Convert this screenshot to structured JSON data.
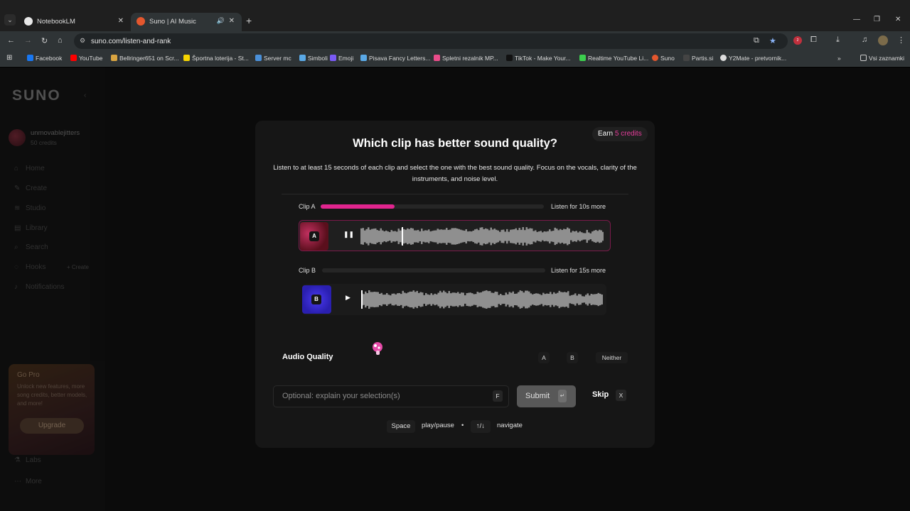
{
  "browser": {
    "tabs": [
      {
        "title": "NotebookLM",
        "active": false
      },
      {
        "title": "Suno | AI Music",
        "active": true
      }
    ],
    "url": "suno.com/listen-and-rank",
    "extension_badge": "2",
    "bookmarks": [
      {
        "label": "Facebook",
        "color": "#1877f2"
      },
      {
        "label": "YouTube",
        "color": "#ff0000"
      },
      {
        "label": "Bellringer651 on Scr...",
        "color": "#d9a441"
      },
      {
        "label": "Športna loterija - St...",
        "color": "#f5d400"
      },
      {
        "label": "Server mc",
        "color": "#4a90d9"
      },
      {
        "label": "Simboli",
        "color": "#5aa9e6"
      },
      {
        "label": "Emoji",
        "color": "#7a5af5"
      },
      {
        "label": "Pisava Fancy Letters...",
        "color": "#5aa9e6"
      },
      {
        "label": "Spletni rezalnik MP...",
        "color": "#e94c8a"
      },
      {
        "label": "TikTok - Make Your...",
        "color": "#111111"
      },
      {
        "label": "Realtime YouTube Li...",
        "color": "#3ccf4e"
      },
      {
        "label": "Suno",
        "color": "#e4572e"
      },
      {
        "label": "Partis.si",
        "color": "#444444"
      },
      {
        "label": "Y2Mate - pretvornik...",
        "color": "#dddddd"
      }
    ],
    "bookmarks_folder": "Vsi zaznamki"
  },
  "sidebar": {
    "logo": "SUNO",
    "username": "unmovablejitters",
    "credits": "50 credits",
    "nav": [
      {
        "label": "Home",
        "icon": "home-icon"
      },
      {
        "label": "Create",
        "icon": "create-icon"
      },
      {
        "label": "Studio",
        "icon": "studio-icon"
      },
      {
        "label": "Library",
        "icon": "library-icon"
      },
      {
        "label": "Search",
        "icon": "search-icon"
      },
      {
        "label": "Hooks",
        "icon": "hooks-icon"
      },
      {
        "label": "Notifications",
        "icon": "bell-icon"
      }
    ],
    "hooks_create": "+ Create",
    "gopro": {
      "title": "Go Pro",
      "desc": "Unlock new features, more song credits, better models, and more!",
      "button": "Upgrade"
    },
    "labs": "Labs",
    "more": "More"
  },
  "modal": {
    "earn_prefix": "Earn",
    "earn_credits": "5 credits",
    "title": "Which clip has better sound quality?",
    "description": "Listen to at least 15 seconds of each clip and select the one with the best sound quality. Focus on the vocals, clarity of the instruments, and noise level.",
    "clips": [
      {
        "label": "Clip A",
        "badge": "A",
        "listen_text": "Listen for 10s more",
        "progress": 0.33,
        "state": "playing",
        "playhead": 0.17
      },
      {
        "label": "Clip B",
        "badge": "B",
        "listen_text": "Listen for 15s more",
        "progress": 0.0,
        "state": "paused",
        "playhead": 0.0
      }
    ],
    "quality_label": "Audio Quality",
    "choices": [
      "A",
      "B",
      "Neither"
    ],
    "explain_placeholder": "Optional: explain your selection(s)",
    "explain_key": "F",
    "submit_label": "Submit",
    "submit_key": "↵",
    "skip_label": "Skip",
    "skip_key": "X",
    "hints": {
      "space_key": "Space",
      "space_text": "play/pause",
      "separator": "•",
      "nav_key": "↑/↓",
      "nav_text": "navigate"
    }
  },
  "colors": {
    "accent": "#e1258f",
    "clip_a": "#8b1a2b",
    "clip_b": "#3b2bd9"
  }
}
